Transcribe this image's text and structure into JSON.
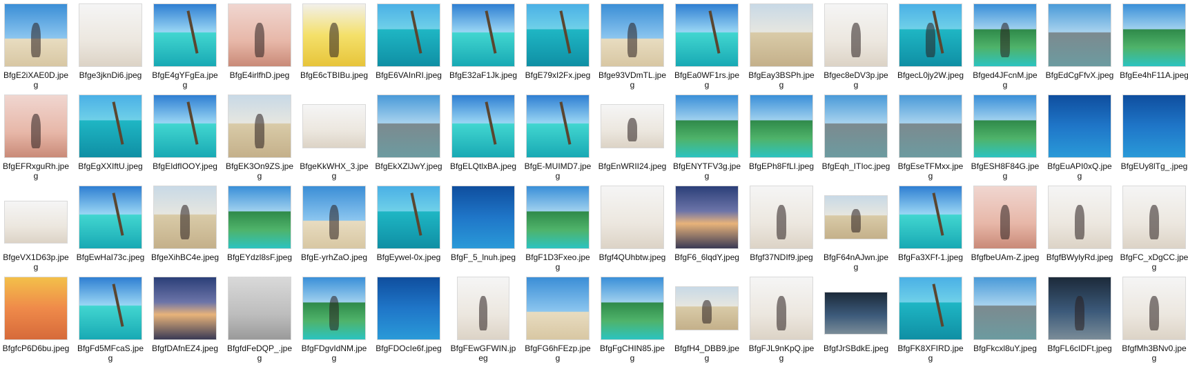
{
  "files": [
    {
      "name": "BfgE2iXAE0D.jpeg",
      "kind": "sky",
      "shape": "square",
      "fig": true
    },
    {
      "name": "Bfge3jknDi6.jpeg",
      "kind": "white",
      "shape": "square",
      "fig": false
    },
    {
      "name": "BfgE4gYFgEa.jpeg",
      "kind": "lagoon",
      "shape": "square",
      "fig": false
    },
    {
      "name": "BfgE4irlfhD.jpeg",
      "kind": "pink",
      "shape": "square",
      "fig": true
    },
    {
      "name": "BfgE6cTBIBu.jpeg",
      "kind": "yellow",
      "shape": "square",
      "fig": true
    },
    {
      "name": "BfgE6VAInRI.jpeg",
      "kind": "sea",
      "shape": "square",
      "fig": false
    },
    {
      "name": "BfgE32aF1Jk.jpeg",
      "kind": "lagoon",
      "shape": "square",
      "fig": false
    },
    {
      "name": "BfgE79xI2Fx.jpeg",
      "kind": "sea",
      "shape": "square",
      "fig": false
    },
    {
      "name": "Bfge93VDmTL.jpeg",
      "kind": "sky",
      "shape": "square",
      "fig": true
    },
    {
      "name": "BfgEa0WF1rs.jpeg",
      "kind": "lagoon",
      "shape": "square",
      "fig": false
    },
    {
      "name": "BfgEay3BSPh.jpeg",
      "kind": "sand",
      "shape": "square",
      "fig": false
    },
    {
      "name": "Bfgec8eDV3p.jpeg",
      "kind": "white",
      "shape": "square",
      "fig": true
    },
    {
      "name": "BfgecL0jy2W.jpeg",
      "kind": "sea",
      "shape": "square",
      "fig": true
    },
    {
      "name": "Bfged4JFcnM.jpeg",
      "kind": "green",
      "shape": "square",
      "fig": true
    },
    {
      "name": "BfgEdCgFfvX.jpeg",
      "kind": "rock",
      "shape": "square",
      "fig": false
    },
    {
      "name": "BfgEe4hF11A.jpeg",
      "kind": "green",
      "shape": "square",
      "fig": false
    },
    {
      "name": "BfgEFRxguRh.jpeg",
      "kind": "pink",
      "shape": "square",
      "fig": true
    },
    {
      "name": "BfgEgXXIftU.jpeg",
      "kind": "sea",
      "shape": "square",
      "fig": false
    },
    {
      "name": "BfgEIdfIOOY.jpeg",
      "kind": "lagoon",
      "shape": "square",
      "fig": false
    },
    {
      "name": "BfgEK3On9ZS.jpeg",
      "kind": "sand",
      "shape": "square",
      "fig": true
    },
    {
      "name": "BfgeKkWHX_3.jpeg",
      "kind": "white",
      "shape": "wide",
      "fig": false
    },
    {
      "name": "BfgEkXZlJwY.jpeg",
      "kind": "rock",
      "shape": "square",
      "fig": false
    },
    {
      "name": "BfgELQtlxBA.jpeg",
      "kind": "lagoon",
      "shape": "square",
      "fig": false
    },
    {
      "name": "BfgE-MUIMD7.jpeg",
      "kind": "lagoon",
      "shape": "square",
      "fig": false
    },
    {
      "name": "BfgEnWRII24.jpeg",
      "kind": "white",
      "shape": "wide",
      "fig": true
    },
    {
      "name": "BfgENYTFV3g.jpeg",
      "kind": "green",
      "shape": "square",
      "fig": false
    },
    {
      "name": "BfgEPh8FfLI.jpeg",
      "kind": "green",
      "shape": "square",
      "fig": false
    },
    {
      "name": "BfgEqh_ITIoc.jpeg",
      "kind": "rock",
      "shape": "square",
      "fig": false
    },
    {
      "name": "BfgEseTFMxx.jpeg",
      "kind": "rock",
      "shape": "square",
      "fig": false
    },
    {
      "name": "BfgESH8F84G.jpeg",
      "kind": "green",
      "shape": "square",
      "fig": false
    },
    {
      "name": "BfgEuAPI0xQ.jpeg",
      "kind": "deep",
      "shape": "square",
      "fig": false
    },
    {
      "name": "BfgEUy8lTg_.jpeg",
      "kind": "deep",
      "shape": "square",
      "fig": false
    },
    {
      "name": "BfgeVX1D63p.jpeg",
      "kind": "white",
      "shape": "wide2",
      "fig": false
    },
    {
      "name": "BfgEwHaI73c.jpeg",
      "kind": "lagoon",
      "shape": "square",
      "fig": false
    },
    {
      "name": "BfgeXihBC4e.jpeg",
      "kind": "sand",
      "shape": "square",
      "fig": true
    },
    {
      "name": "BfgEYdzl8sF.jpeg",
      "kind": "green",
      "shape": "square",
      "fig": false
    },
    {
      "name": "BfgE-yrhZaO.jpeg",
      "kind": "sky",
      "shape": "square",
      "fig": true
    },
    {
      "name": "BfgEywel-0x.jpeg",
      "kind": "sea",
      "shape": "square",
      "fig": false
    },
    {
      "name": "BfgF_5_lnuh.jpeg",
      "kind": "deep",
      "shape": "square",
      "fig": false
    },
    {
      "name": "BfgF1D3Fxeo.jpeg",
      "kind": "green",
      "shape": "square",
      "fig": false
    },
    {
      "name": "Bfgf4QUhbtw.jpeg",
      "kind": "white",
      "shape": "square",
      "fig": false
    },
    {
      "name": "BfgF6_6lqdY.jpeg",
      "kind": "sunset",
      "shape": "square",
      "fig": false
    },
    {
      "name": "Bfgf37NDIf9.jpeg",
      "kind": "white",
      "shape": "square",
      "fig": true
    },
    {
      "name": "BfgF64nAJwn.jpeg",
      "kind": "sand",
      "shape": "wide",
      "fig": true
    },
    {
      "name": "BfgFa3XFf-1.jpeg",
      "kind": "lagoon",
      "shape": "square",
      "fig": false
    },
    {
      "name": "BfgfbeUAm-Z.jpeg",
      "kind": "pink",
      "shape": "square",
      "fig": true
    },
    {
      "name": "BfgfBWylyRd.jpeg",
      "kind": "white",
      "shape": "square",
      "fig": true
    },
    {
      "name": "BfgFC_xDgCC.jpeg",
      "kind": "white",
      "shape": "square",
      "fig": true
    },
    {
      "name": "BfgfcP6D6bu.jpeg",
      "kind": "food",
      "shape": "square",
      "fig": false
    },
    {
      "name": "BfgFd5MFcaS.jpeg",
      "kind": "lagoon",
      "shape": "square",
      "fig": false
    },
    {
      "name": "BfgfDAfnEZ4.jpeg",
      "kind": "sunset",
      "shape": "square",
      "fig": false
    },
    {
      "name": "BfgfdFeDQP_.jpeg",
      "kind": "grey",
      "shape": "square",
      "fig": false
    },
    {
      "name": "BfgFDgvIdNM.jpeg",
      "kind": "green",
      "shape": "square",
      "fig": true
    },
    {
      "name": "BfgFDOcIe6f.jpeg",
      "kind": "deep",
      "shape": "square",
      "fig": false
    },
    {
      "name": "BfgFEwGFWIN.jpeg",
      "kind": "white",
      "shape": "tall",
      "fig": true
    },
    {
      "name": "BfgFG6hFEzp.jpeg",
      "kind": "sky",
      "shape": "square",
      "fig": false
    },
    {
      "name": "BfgFgCHIN85.jpeg",
      "kind": "green",
      "shape": "square",
      "fig": false
    },
    {
      "name": "BfgfH4_DBB9.jpeg",
      "kind": "sand",
      "shape": "wide",
      "fig": true
    },
    {
      "name": "BfgFJL9nKpQ.jpeg",
      "kind": "white",
      "shape": "square",
      "fig": true
    },
    {
      "name": "BfgfJrSBdkE.jpeg",
      "kind": "dark",
      "shape": "wide2",
      "fig": false
    },
    {
      "name": "BfgFK8XFIRD.jpeg",
      "kind": "sea",
      "shape": "square",
      "fig": false
    },
    {
      "name": "BfgFkcxl8uY.jpeg",
      "kind": "rock",
      "shape": "square",
      "fig": false
    },
    {
      "name": "BfgFL6cIDFt.jpeg",
      "kind": "dark",
      "shape": "square",
      "fig": true
    },
    {
      "name": "BfgfMh3BNv0.jpeg",
      "kind": "white",
      "shape": "square",
      "fig": true
    }
  ]
}
